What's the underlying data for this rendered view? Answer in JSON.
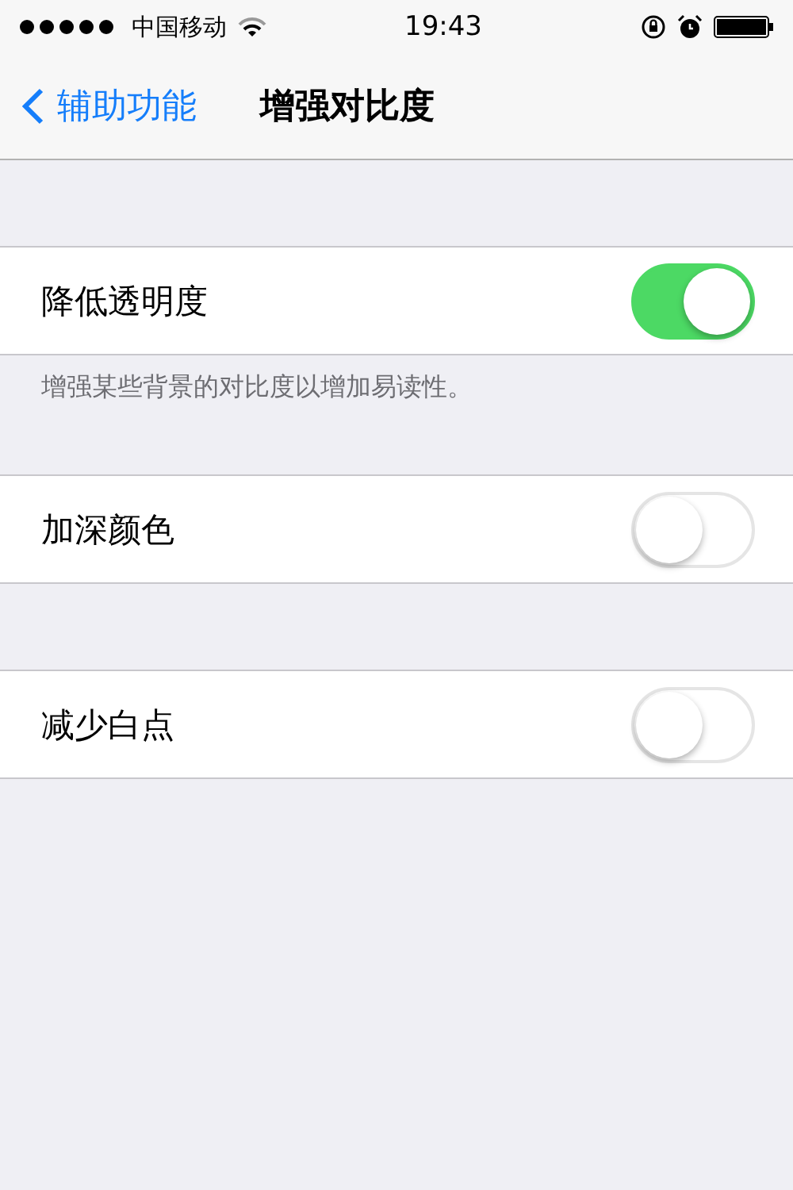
{
  "status_bar": {
    "carrier": "中国移动",
    "time": "19:43"
  },
  "nav": {
    "back": "辅助功能",
    "title": "增强对比度"
  },
  "groups": [
    {
      "rows": [
        {
          "label": "降低透明度",
          "on": true
        }
      ],
      "footer": "增强某些背景的对比度以增加易读性。"
    },
    {
      "rows": [
        {
          "label": "加深颜色",
          "on": false
        }
      ]
    },
    {
      "rows": [
        {
          "label": "减少白点",
          "on": false
        }
      ]
    }
  ]
}
